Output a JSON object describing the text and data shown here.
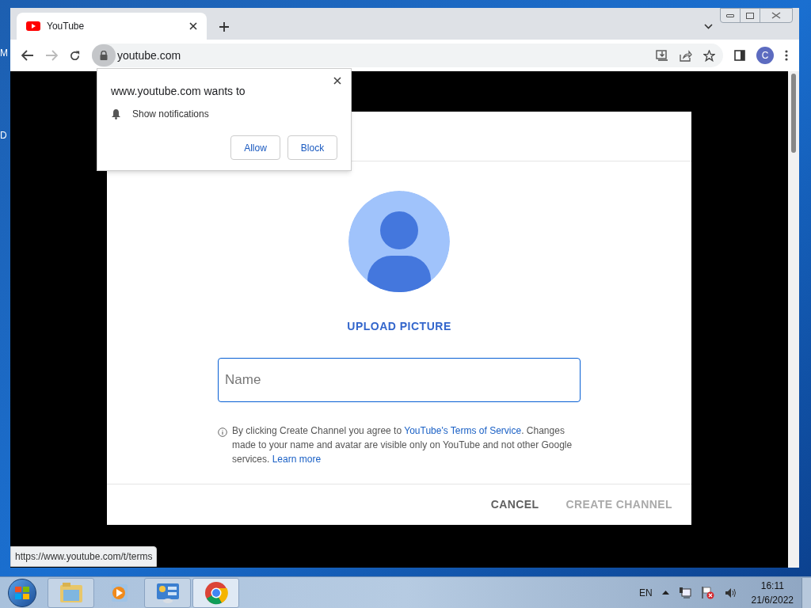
{
  "desktop_labels": [
    "M",
    "D"
  ],
  "browser": {
    "tabs": [
      {
        "title": "YouTube",
        "selected": true
      }
    ],
    "address": "youtube.com",
    "profile_initial": "C"
  },
  "permission_popup": {
    "title": "www.youtube.com wants to",
    "permission": "Show notifications",
    "buttons": [
      "Allow",
      "Block"
    ]
  },
  "dialog": {
    "upload_label": "UPLOAD PICTURE",
    "name_field": {
      "placeholder": "Name",
      "focused": true
    },
    "terms": {
      "before": "By clicking Create Channel you agree to ",
      "link": "YouTube's Terms of Service",
      "after": ". Changes made to your name and avatar are visible only on YouTube and not other Google services. ",
      "learn_more": "Learn more"
    },
    "buttons": [
      {
        "label": "CANCEL",
        "disabled": false
      },
      {
        "label": "CREATE CHANNEL",
        "disabled": true
      }
    ]
  },
  "status_url": "https://www.youtube.com/t/terms",
  "taskbar": {
    "apps": [
      {
        "kind": "folder",
        "selected": false
      },
      {
        "kind": "media",
        "selected": false
      },
      {
        "kind": "panel",
        "selected": false
      },
      {
        "kind": "chrome",
        "selected": true
      }
    ],
    "language": "EN",
    "time": "16:11",
    "date": "21/6/2022"
  }
}
